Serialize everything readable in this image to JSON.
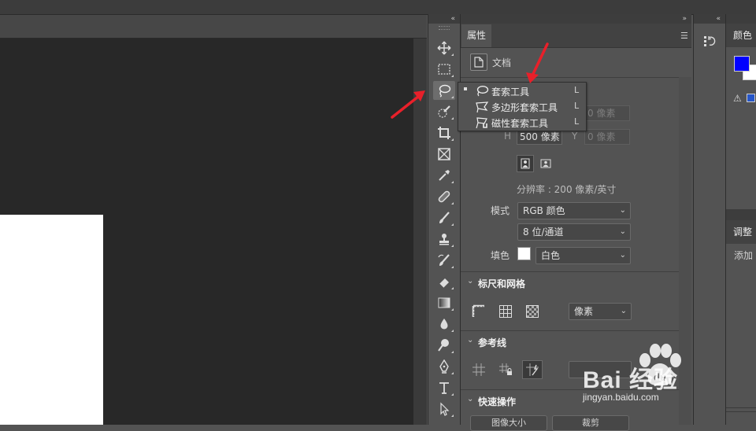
{
  "toolbar": {
    "collapse_glyph": "«",
    "tools": [
      {
        "id": "move",
        "icon": "move-icon"
      },
      {
        "id": "marquee",
        "icon": "rect-marquee-icon"
      },
      {
        "id": "lasso",
        "icon": "lasso-icon",
        "active": true
      },
      {
        "id": "quick-select",
        "icon": "quick-select-icon"
      },
      {
        "id": "crop",
        "icon": "crop-icon"
      },
      {
        "id": "frame",
        "icon": "frame-icon"
      },
      {
        "id": "eyedropper",
        "icon": "eyedropper-icon"
      },
      {
        "id": "healing",
        "icon": "healing-brush-icon"
      },
      {
        "id": "brush",
        "icon": "brush-icon"
      },
      {
        "id": "stamp",
        "icon": "clone-stamp-icon"
      },
      {
        "id": "history-brush",
        "icon": "history-brush-icon"
      },
      {
        "id": "eraser",
        "icon": "eraser-icon"
      },
      {
        "id": "gradient",
        "icon": "gradient-icon"
      },
      {
        "id": "blur",
        "icon": "blur-icon"
      },
      {
        "id": "dodge",
        "icon": "dodge-icon"
      },
      {
        "id": "pen",
        "icon": "pen-icon"
      },
      {
        "id": "type",
        "icon": "type-icon"
      },
      {
        "id": "path-select",
        "icon": "path-select-icon"
      }
    ]
  },
  "flyout": {
    "items": [
      {
        "label": "套索工具",
        "shortcut": "L",
        "selected": true,
        "icon": "lasso-icon"
      },
      {
        "label": "多边形套索工具",
        "shortcut": "L",
        "selected": false,
        "icon": "polygonal-lasso-icon"
      },
      {
        "label": "磁性套索工具",
        "shortcut": "L",
        "selected": false,
        "icon": "magnetic-lasso-icon"
      }
    ]
  },
  "properties": {
    "collapse_glyph": "»",
    "tab_label": "属性",
    "doc_label": "文档",
    "canvas": {
      "w_value": "",
      "x_label": "X",
      "x_value": "0 像素",
      "h_label": "H",
      "h_value": "500 像素",
      "y_label": "Y",
      "y_value": "0 像素",
      "resolution_text": "分辨率 : 200 像素/英寸"
    },
    "mode_label": "模式",
    "mode_value": "RGB 颜色",
    "depth_value": "8 位/通道",
    "fill_label": "填色",
    "fill_value": "白色",
    "rulers_section": "标尺和网格",
    "units_value": "像素",
    "guides_section": "参考线",
    "quick_actions_section": "快速操作",
    "action_buttons": [
      "图像大小",
      "裁剪"
    ]
  },
  "right_panels": {
    "collapse_glyph": "«",
    "color_tab": "颜色",
    "adjust_tab": "调整",
    "adjust_add": "添加",
    "foreground_color": "#0000ff",
    "background_color": "#ffffff"
  },
  "watermark": {
    "brand_text": "Bai 经验",
    "site_text": "jingyan.baidu.com"
  },
  "colors": {
    "annotation_arrow": "#e8202a"
  }
}
